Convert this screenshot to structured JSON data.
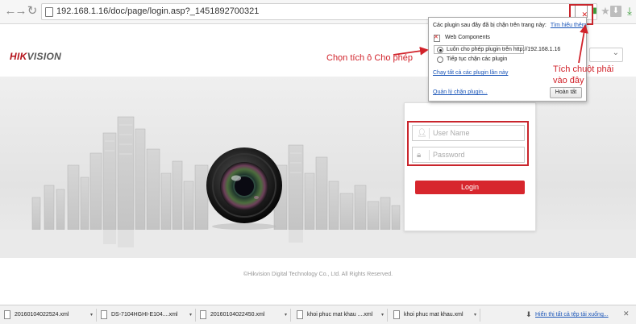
{
  "browser": {
    "url": "192.168.1.16/doc/page/login.asp?_1451892700321"
  },
  "header": {
    "brand_red": "HIK",
    "brand_grey": "VISION"
  },
  "login": {
    "username_placeholder": "User Name",
    "password_placeholder": "Password",
    "button_label": "Login"
  },
  "footer": {
    "copyright": "©Hikvision Digital Technology Co., Ltd. All Rights Reserved."
  },
  "plugin_popup": {
    "intro": "Các plugin sau đây đã bị chặn trên trang này:",
    "intro_link": "Tìm hiểu thêm",
    "plugin_name": "Web Components",
    "option_allow": "Luôn cho phép plugin trên http://192.168.1.16",
    "option_block": "Tiếp tục chặn các plugin",
    "run_all_link": "Chạy tất cả các plugin lần này",
    "manage_link": "Quản lý chặn plugin...",
    "done_button": "Hoàn tất",
    "selected_option": "allow"
  },
  "annotations": {
    "choose_allow": "Chọn tích ô Cho phép",
    "right_click_line1": "Tích chuột phải",
    "right_click_line2": "vào đây",
    "color": "#d1222a"
  },
  "downloads": {
    "items": [
      "20160104022524.xml",
      "DS-7104HGHI-E104....xml",
      "20160104022450.xml",
      "khoi phuc mat khau ....xml",
      "khoi phuc mat khau.xml"
    ],
    "show_all": "Hiển thị tất cả tệp tải xuống..."
  },
  "colors": {
    "brand_red": "#b5121b",
    "login_button": "#d7262d",
    "link": "#1a55b8",
    "annotation_box": "#c9252c"
  }
}
